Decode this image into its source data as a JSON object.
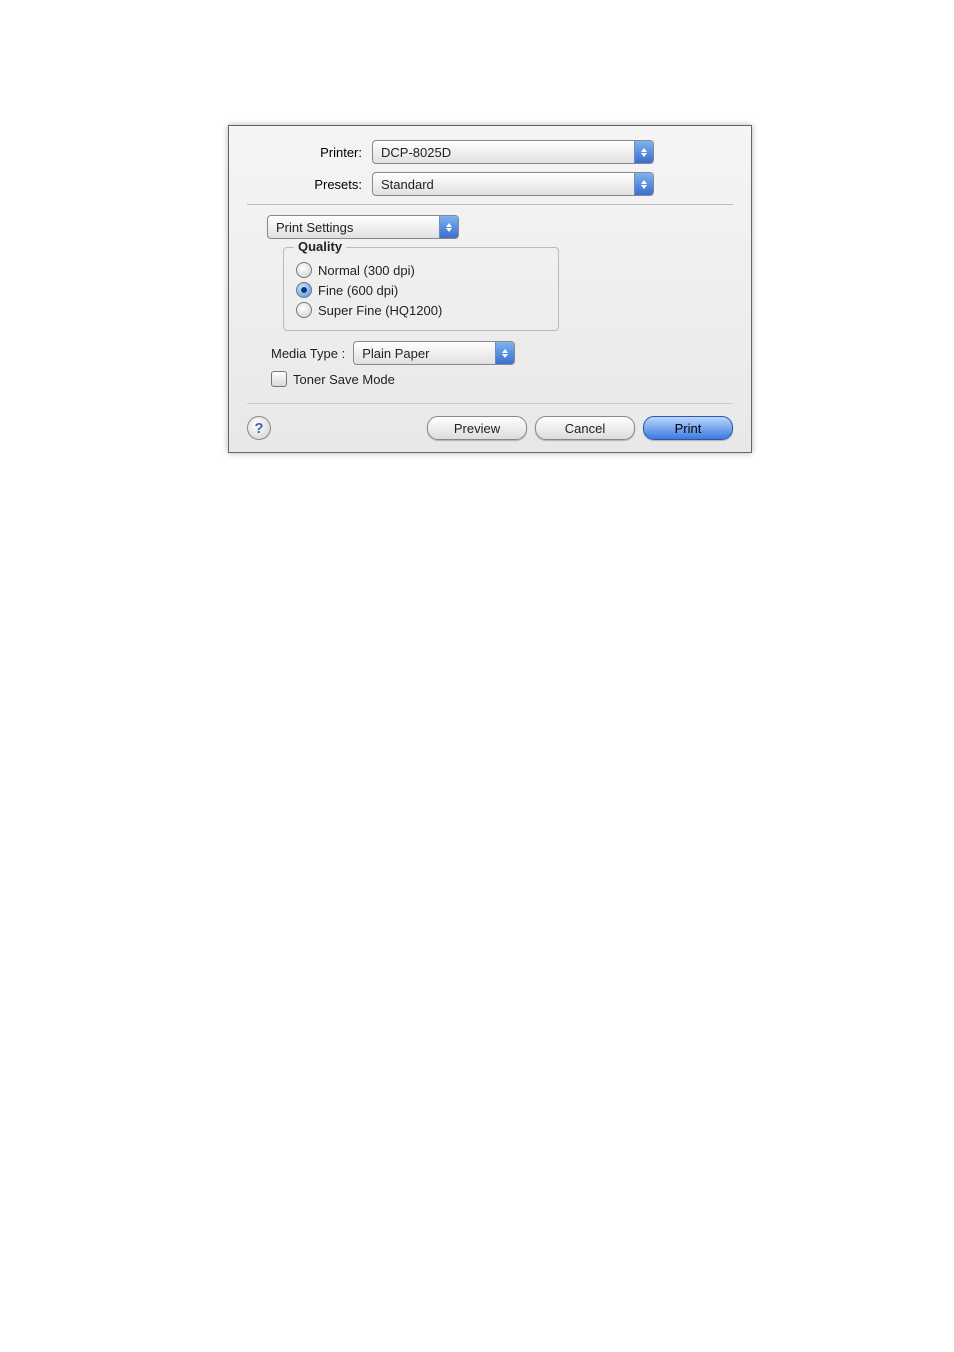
{
  "labels": {
    "printer": "Printer:",
    "presets": "Presets:",
    "media_type": "Media Type :",
    "quality_legend": "Quality"
  },
  "dropdowns": {
    "printer_value": "DCP-8025D",
    "presets_value": "Standard",
    "section_value": "Print Settings",
    "media_type_value": "Plain Paper"
  },
  "quality_options": {
    "normal": "Normal (300 dpi)",
    "fine": "Fine (600 dpi)",
    "superfine": "Super Fine (HQ1200)"
  },
  "quality_selected": "fine",
  "toner_save": {
    "label": "Toner Save Mode",
    "checked": false
  },
  "buttons": {
    "help": "?",
    "preview": "Preview",
    "cancel": "Cancel",
    "print": "Print"
  }
}
